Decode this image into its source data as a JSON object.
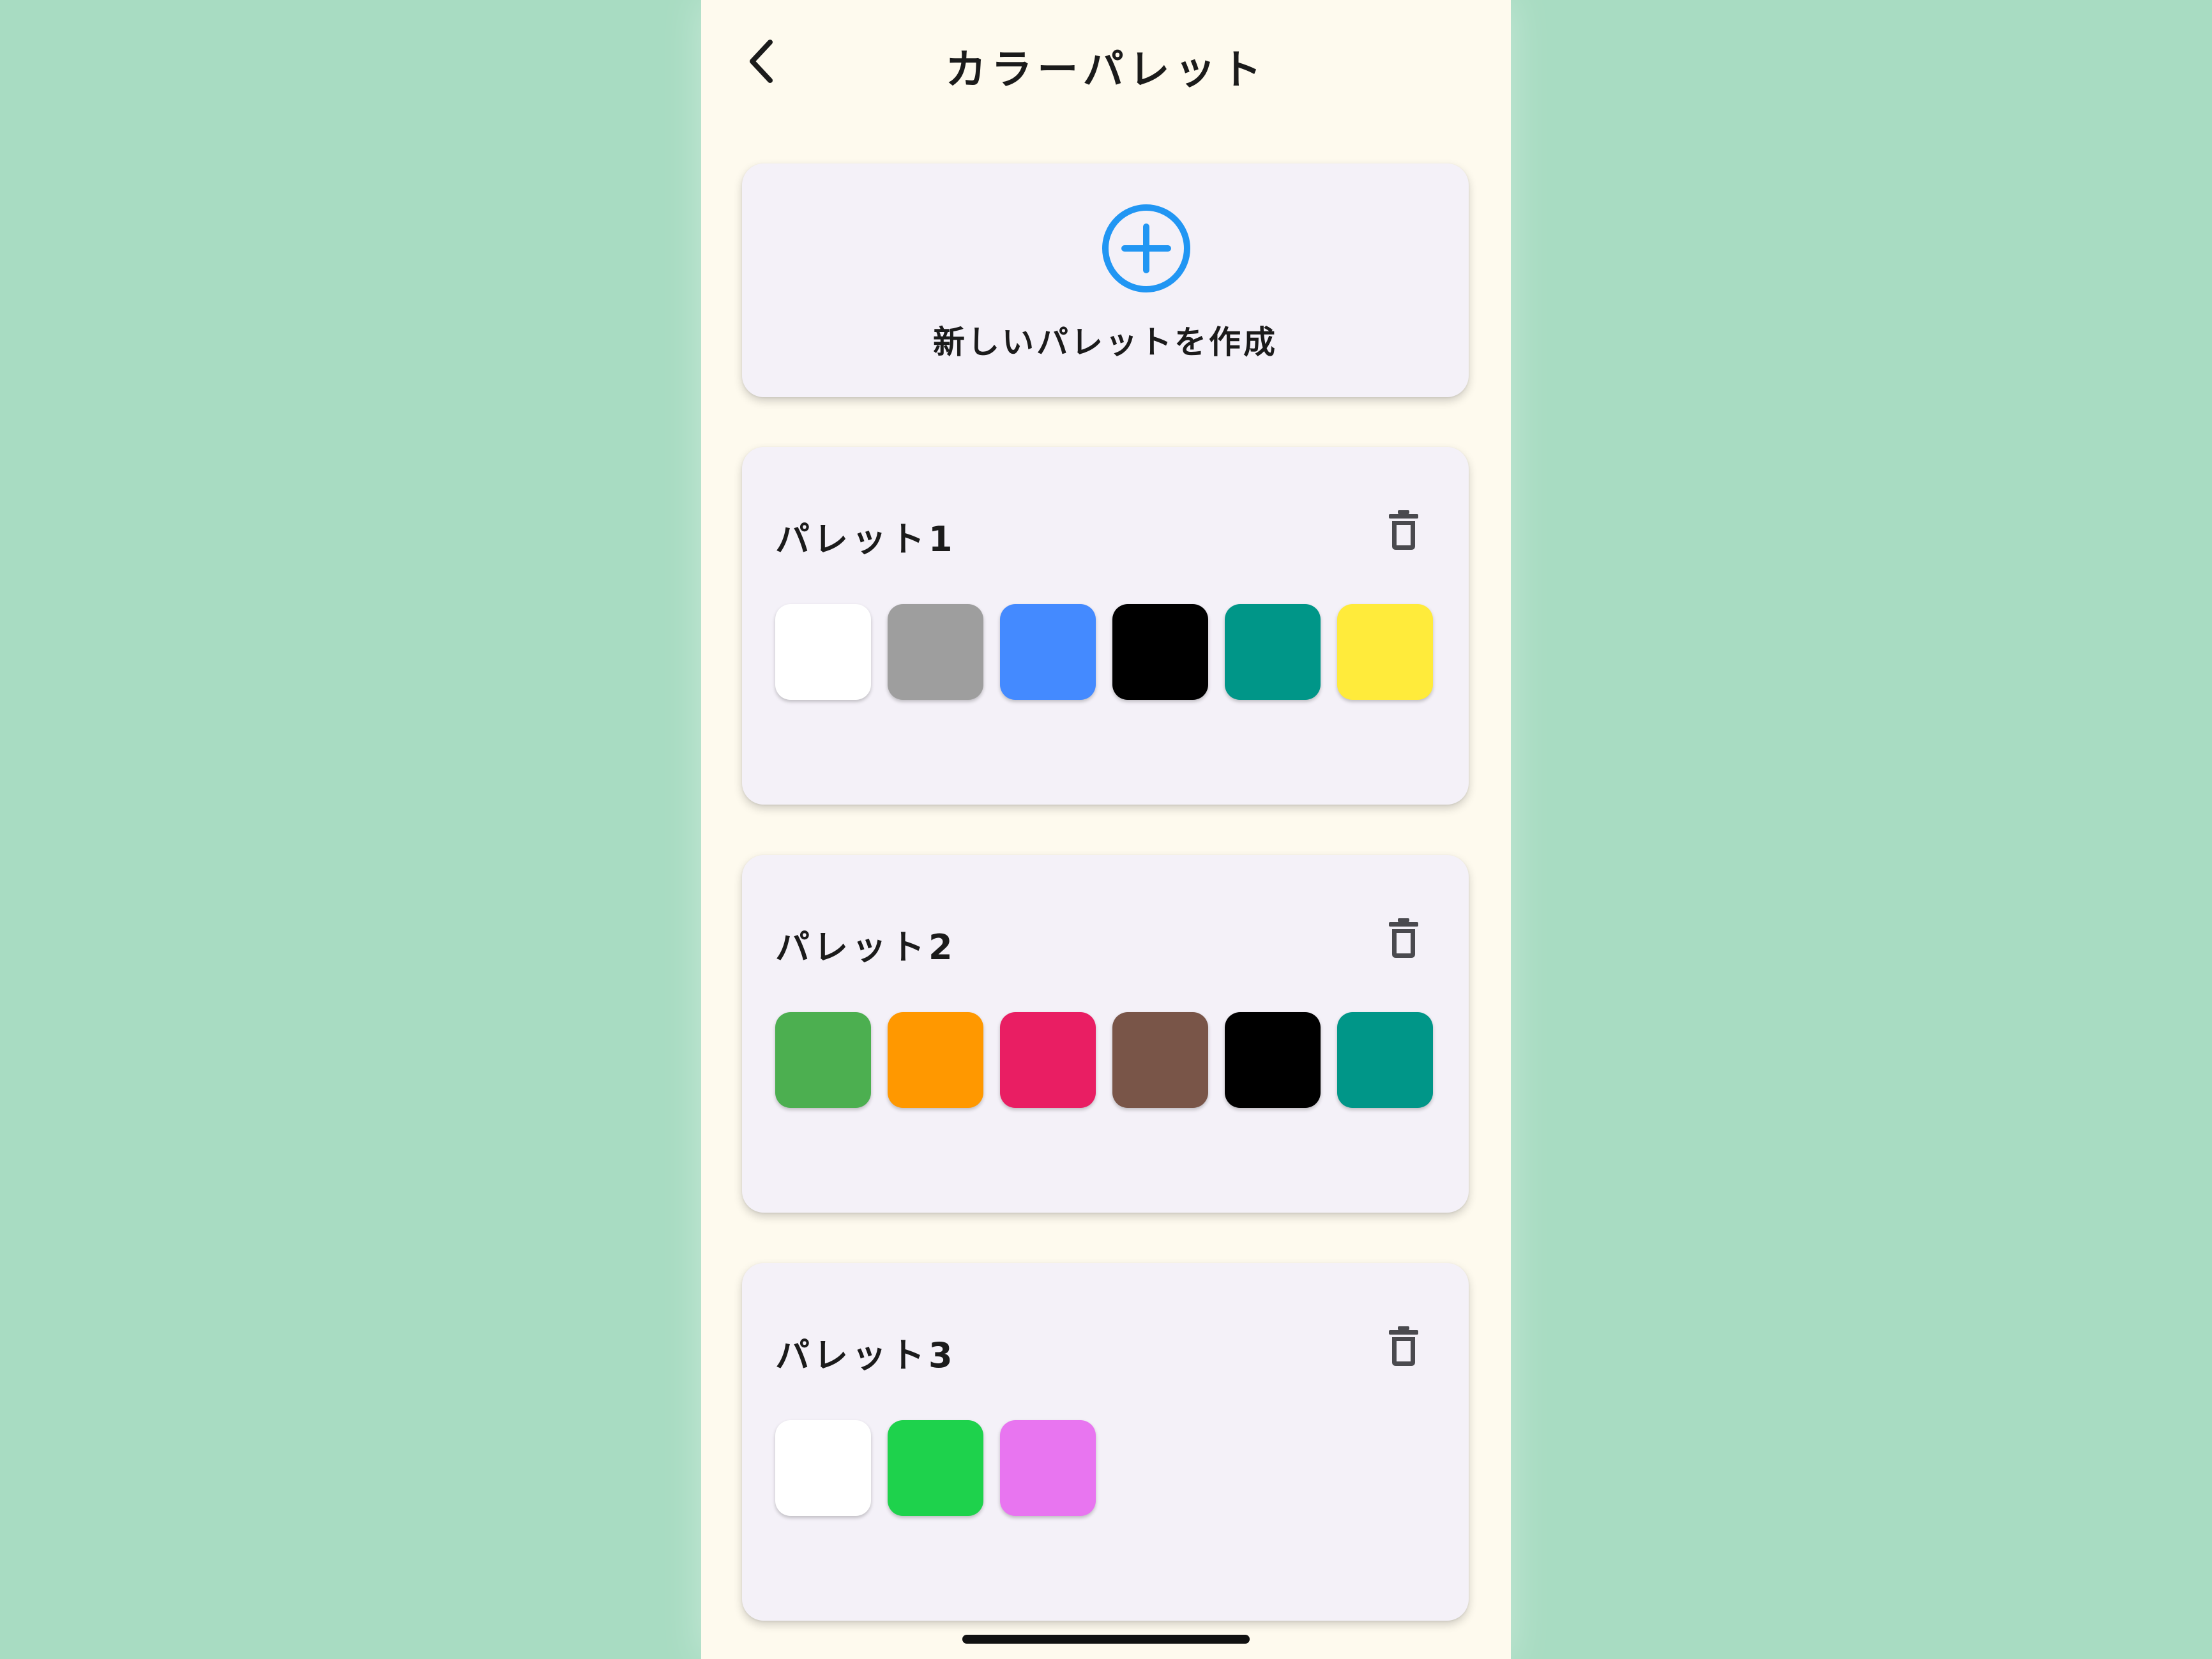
{
  "header": {
    "title": "カラーパレット",
    "back_icon": "chevron-left-icon"
  },
  "new_palette": {
    "icon": "plus-circle-icon",
    "label": "新しいパレットを作成",
    "accent_color": "#2196F3"
  },
  "palettes": [
    {
      "name": "パレット1",
      "delete_icon": "trash-icon",
      "colors": [
        "#FFFFFF",
        "#9E9E9E",
        "#448AFF",
        "#000000",
        "#009688",
        "#FFEB3B"
      ]
    },
    {
      "name": "パレット2",
      "delete_icon": "trash-icon",
      "colors": [
        "#4CAF50",
        "#FF9800",
        "#E91E63",
        "#795548",
        "#000000",
        "#009688"
      ]
    },
    {
      "name": "パレット3",
      "delete_icon": "trash-icon",
      "colors": [
        "#FFFFFF",
        "#1ED24C",
        "#E875F0"
      ]
    }
  ],
  "colors": {
    "page_background": "#A8DCC2",
    "app_background": "#FEFAEE",
    "card_background": "#F4F1F8"
  }
}
